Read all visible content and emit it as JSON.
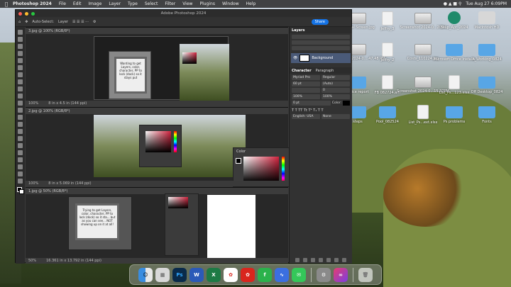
{
  "menubar": {
    "app_name": "Photoshop 2024",
    "items": [
      "File",
      "Edit",
      "Image",
      "Layer",
      "Type",
      "Select",
      "Filter",
      "View",
      "Plugins",
      "Window",
      "Help"
    ],
    "datetime": "Tue Aug 27  6:09PM"
  },
  "window": {
    "title": "Adobe Photoshop 2024",
    "options": {
      "auto_select": "Auto-Select:",
      "target": "Layer",
      "share": "Share"
    }
  },
  "documents": [
    {
      "tab": "3.jpg @ 100% (RGB/8*)",
      "zoom": "100%",
      "size": "8 in x 4.5 in (144 ppi)"
    },
    {
      "tab": "2.jpg @ 100% (RGB/8*)",
      "zoom": "100%",
      "size": "8 in x 5.069 in (144 ppi)"
    },
    {
      "tab": "1.jpg @ 50% (RGB/8*)",
      "zoom": "50%",
      "size": "16.361 in x 13.792 in (144 ppi)"
    }
  ],
  "card_text_1": "Wanting to get Layers, color, character, PP to lock (dock) so it stays put",
  "card_text_2": "Trying to get Layers, color, character, PP to lock (dock) so it sta... but as you can see... NOT showing up on it at all!",
  "colors": {
    "accent": "#1473e6",
    "layer_sel": "#4a5a78",
    "picker_red": "#d2233e"
  },
  "panels": {
    "layers": {
      "title": "Layers",
      "layer_name": "Background"
    },
    "character": {
      "tabs": [
        "Character",
        "Paragraph"
      ],
      "font": "Myriad Pro",
      "style": "Regular",
      "size": "60 pt",
      "leading": "(Auto)",
      "tracking": "0",
      "scale_v": "100%",
      "scale_h": "100%",
      "baseline": "0 pt",
      "color_label": "Color:",
      "language": "English: USA",
      "aa": "None"
    },
    "color_floating": {
      "title": "Color"
    }
  },
  "desktop": {
    "icons": [
      {
        "label": "Minimal Screen.jpg",
        "kind": "shot"
      },
      {
        "label": "Jeffry_3",
        "kind": "file"
      },
      {
        "label": "Screenshot 2024-0...2024",
        "kind": "shot"
      },
      {
        "label": "Bkup_Apr_2024",
        "kind": "clock"
      },
      {
        "label": "Macintosh HD",
        "kind": "drive"
      },
      {
        "label": "Screenshot 2024-0....47.48 PM",
        "kind": "shot"
      },
      {
        "label": "Jeffry_2",
        "kind": "file"
      },
      {
        "label": "Costs_110224.jpg",
        "kind": "shot"
      },
      {
        "label": "Microsoft Office Installs",
        "kind": "folder"
      },
      {
        "label": "A_Working_0824",
        "kind": "folder"
      },
      {
        "label": "Police report",
        "kind": "folder"
      },
      {
        "label": "FB 082724.am",
        "kind": "file"
      },
      {
        "label": "Screenshot 2024-0...15.37PM",
        "kind": "shot"
      },
      {
        "label": "List_Ps...123.xlsx",
        "kind": "file"
      },
      {
        "label": "Off Desktop_0824",
        "kind": "folder"
      },
      {
        "label": "steps",
        "kind": "folder"
      },
      {
        "label": "Pool_082524",
        "kind": "folder"
      },
      {
        "label": "List_Ps...ext.xlsx",
        "kind": "file"
      },
      {
        "label": "Ps problems",
        "kind": "folder"
      },
      {
        "label": "Fonts",
        "kind": "folder"
      }
    ]
  },
  "dock": {
    "apps": [
      "finder-icon",
      "launchpad-icon",
      "photoshop-icon",
      "word-icon",
      "excel-icon",
      "acrobat-icon",
      "reader-icon",
      "feedly-icon",
      "shortcuts-icon",
      "messages-icon",
      "settings-icon",
      "creative-cloud-icon",
      "trash-icon"
    ]
  }
}
